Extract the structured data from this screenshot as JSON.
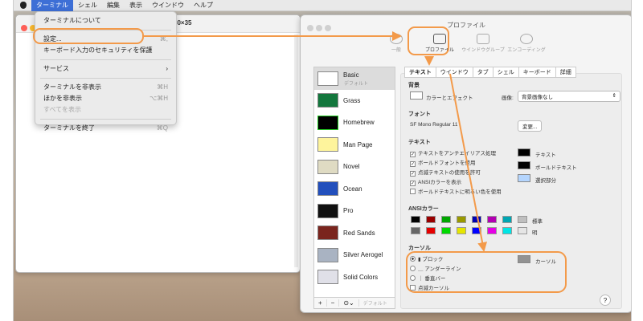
{
  "menubar": {
    "items": [
      "ターミナル",
      "シェル",
      "編集",
      "表示",
      "ウインドウ",
      "ヘルプ"
    ]
  },
  "terminal_window": {
    "title_suffix": "80×35"
  },
  "menu": {
    "items": [
      {
        "label": "ターミナルについて"
      },
      {
        "label": "設定...",
        "shortcut": "⌘,"
      },
      {
        "label": "キーボード入力のセキュリティを保護"
      },
      {
        "label": "サービス",
        "submenu": "›"
      },
      {
        "label": "ターミナルを非表示",
        "shortcut": "⌘H"
      },
      {
        "label": "ほかを非表示",
        "shortcut": "⌥⌘H"
      },
      {
        "label": "すべてを表示"
      },
      {
        "label": "ターミナルを終了",
        "shortcut": "⌘Q"
      }
    ]
  },
  "prefs": {
    "title": "プロファイル",
    "toolbar": [
      "一般",
      "プロファイル",
      "ウインドウグループ",
      "エンコーディング"
    ],
    "profiles": [
      "Basic",
      "Grass",
      "Homebrew",
      "Man Page",
      "Novel",
      "Ocean",
      "Pro",
      "Red Sands",
      "Silver Aerogel",
      "Solid Colors"
    ],
    "default_badge": "デフォルト",
    "bottom": {
      "add": "+",
      "remove": "−",
      "more": "⊙⌄",
      "default_btn": "デフォルト"
    },
    "tabs": [
      "テキスト",
      "ウインドウ",
      "タブ",
      "シェル",
      "キーボード",
      "詳細"
    ],
    "background": {
      "heading": "背景",
      "color_label": "カラーとエフェクト",
      "image_label": "画像:",
      "image_value": "背景画像なし"
    },
    "font": {
      "heading": "フォント",
      "value": "SF Mono Regular 11",
      "change_btn": "変更..."
    },
    "text": {
      "heading": "テキスト",
      "options": [
        "テキストをアンチエイリアス処理",
        "ボールドフォントを使用",
        "点滅テキストの使用を許可",
        "ANSIカラーを表示",
        "ボールドテキストに明るい色を使用"
      ],
      "colors": [
        "テキスト",
        "ボールドテキスト",
        "選択部分"
      ]
    },
    "ansi": {
      "heading": "ANSIカラー",
      "normal_label": "標準",
      "bright_label": "明",
      "normal": [
        "#000000",
        "#990000",
        "#00a600",
        "#999900",
        "#0000b2",
        "#b200b2",
        "#00a6b2",
        "#bfbfbf"
      ],
      "bright": [
        "#666666",
        "#e50000",
        "#00d900",
        "#e5e500",
        "#0000ff",
        "#e500e5",
        "#00e5e5",
        "#e5e5e5"
      ]
    },
    "cursor": {
      "heading": "カーソル",
      "options": [
        "ブロック",
        "アンダーライン",
        "垂直バー"
      ],
      "blink": "点滅カーソル",
      "color_label": "カーソル"
    },
    "help": "?"
  },
  "colors": {
    "accent": "#f39a4a",
    "menu_highlight": "#3d6fd6"
  }
}
